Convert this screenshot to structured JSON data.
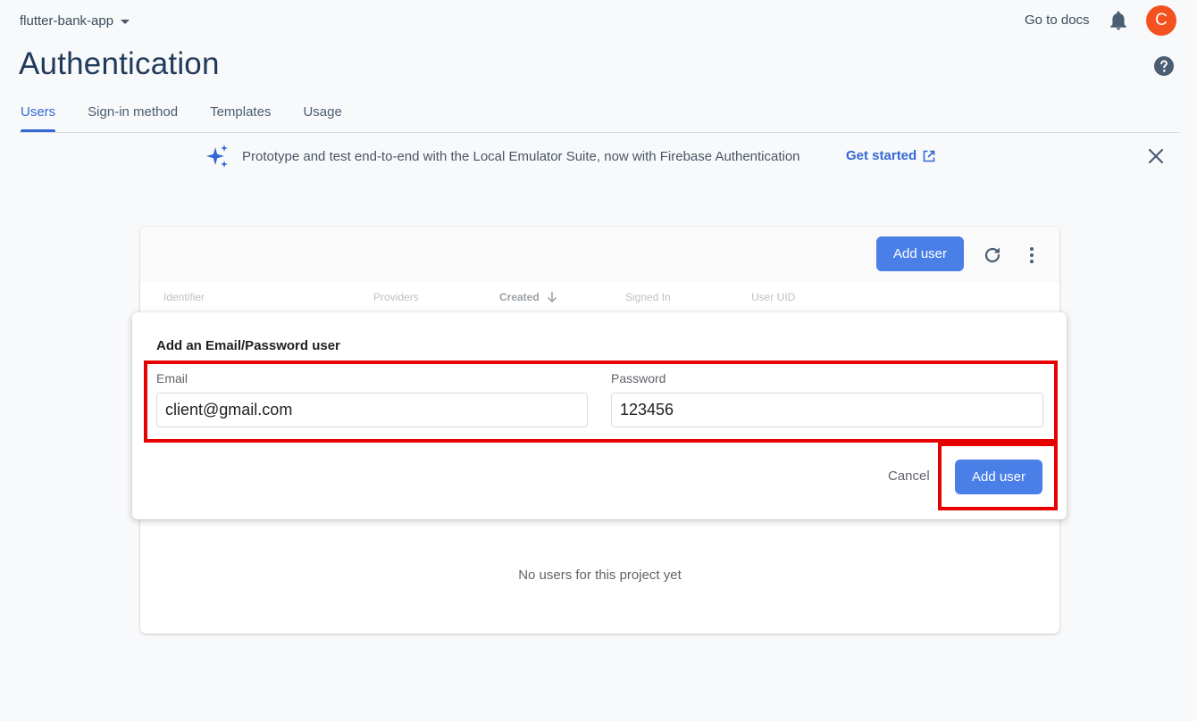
{
  "header": {
    "project_name": "flutter-bank-app",
    "go_to_docs": "Go to docs",
    "avatar_letter": "C",
    "avatar_color": "#f4511e"
  },
  "page": {
    "title": "Authentication"
  },
  "tabs": [
    {
      "label": "Users",
      "active": true
    },
    {
      "label": "Sign-in method",
      "active": false
    },
    {
      "label": "Templates",
      "active": false
    },
    {
      "label": "Usage",
      "active": false
    }
  ],
  "banner": {
    "text": "Prototype and test end-to-end with the Local Emulator Suite, now with Firebase Authentication",
    "link_label": "Get started"
  },
  "users_table": {
    "add_user_label": "Add user",
    "columns": [
      "Identifier",
      "Providers",
      "Created",
      "Signed In",
      "User UID"
    ],
    "sorted_column": "Created",
    "empty_message": "No users for this project yet"
  },
  "dialog": {
    "title": "Add an Email/Password user",
    "email_label": "Email",
    "email_value": "client@gmail.com",
    "password_label": "Password",
    "password_value": "123456",
    "cancel_label": "Cancel",
    "submit_label": "Add user"
  },
  "colors": {
    "accent": "#3367d6",
    "primary_button": "#4a7fe8",
    "highlight": "#e60000"
  }
}
